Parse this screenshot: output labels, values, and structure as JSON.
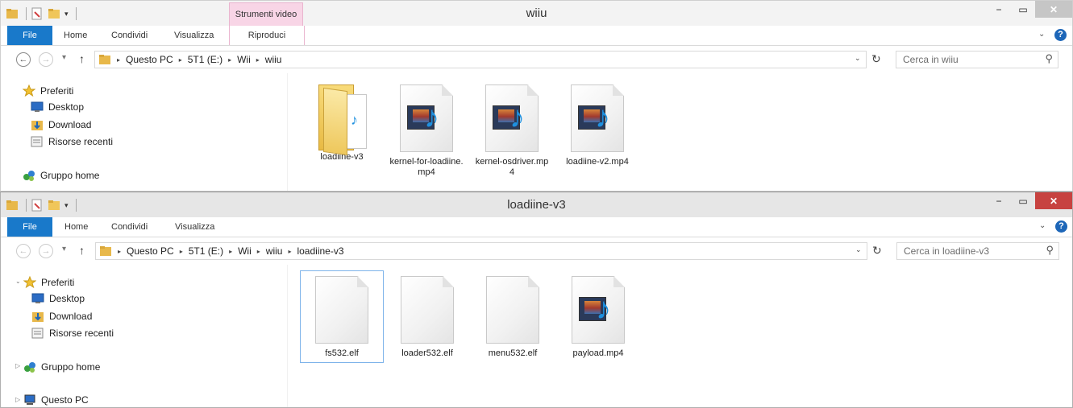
{
  "window_top": {
    "title": "wiiu",
    "context_header": "Strumenti video",
    "tabs": {
      "file": "File",
      "home": "Home",
      "share": "Condividi",
      "view": "Visualizza",
      "play": "Riproduci"
    },
    "breadcrumb": [
      "Questo PC",
      "5T1 (E:)",
      "Wii",
      "wiiu"
    ],
    "search_placeholder": "Cerca in wiiu",
    "nav": {
      "favorites": "Preferiti",
      "desktop": "Desktop",
      "download": "Download",
      "recent": "Risorse recenti",
      "homegroup": "Gruppo home"
    },
    "items": [
      {
        "label": "loadiine-v3",
        "icon": "folder-icon"
      },
      {
        "label": "kernel-for-loadiine.mp4",
        "icon": "video-file-icon"
      },
      {
        "label": "kernel-osdriver.mp4",
        "icon": "video-file-icon"
      },
      {
        "label": "loadiine-v2.mp4",
        "icon": "video-file-icon"
      }
    ]
  },
  "window_bottom": {
    "title": "loadiine-v3",
    "tabs": {
      "file": "File",
      "home": "Home",
      "share": "Condividi",
      "view": "Visualizza"
    },
    "breadcrumb": [
      "Questo PC",
      "5T1 (E:)",
      "Wii",
      "wiiu",
      "loadiine-v3"
    ],
    "search_placeholder": "Cerca in loadiine-v3",
    "nav": {
      "favorites": "Preferiti",
      "desktop": "Desktop",
      "download": "Download",
      "recent": "Risorse recenti",
      "homegroup": "Gruppo home",
      "thispc": "Questo PC"
    },
    "items": [
      {
        "label": "fs532.elf",
        "icon": "blank-file-icon",
        "selected": true
      },
      {
        "label": "loader532.elf",
        "icon": "blank-file-icon"
      },
      {
        "label": "menu532.elf",
        "icon": "blank-file-icon"
      },
      {
        "label": "payload.mp4",
        "icon": "video-file-icon"
      }
    ]
  },
  "colors": {
    "file_tab": "#1979ca",
    "context_tab": "#f8d5e6",
    "close_active": "#c74240",
    "selection": "#7eb4ea"
  },
  "glyphs": {
    "back": "←",
    "forward": "→",
    "up": "↑",
    "down": "⌄",
    "dropdown": "▾",
    "chevron": "▸",
    "refresh": "↻",
    "search": "⚲",
    "help": "?",
    "minimize": "−",
    "maximize": "▭",
    "close": "✕",
    "expand": "▷",
    "note": "♪"
  }
}
